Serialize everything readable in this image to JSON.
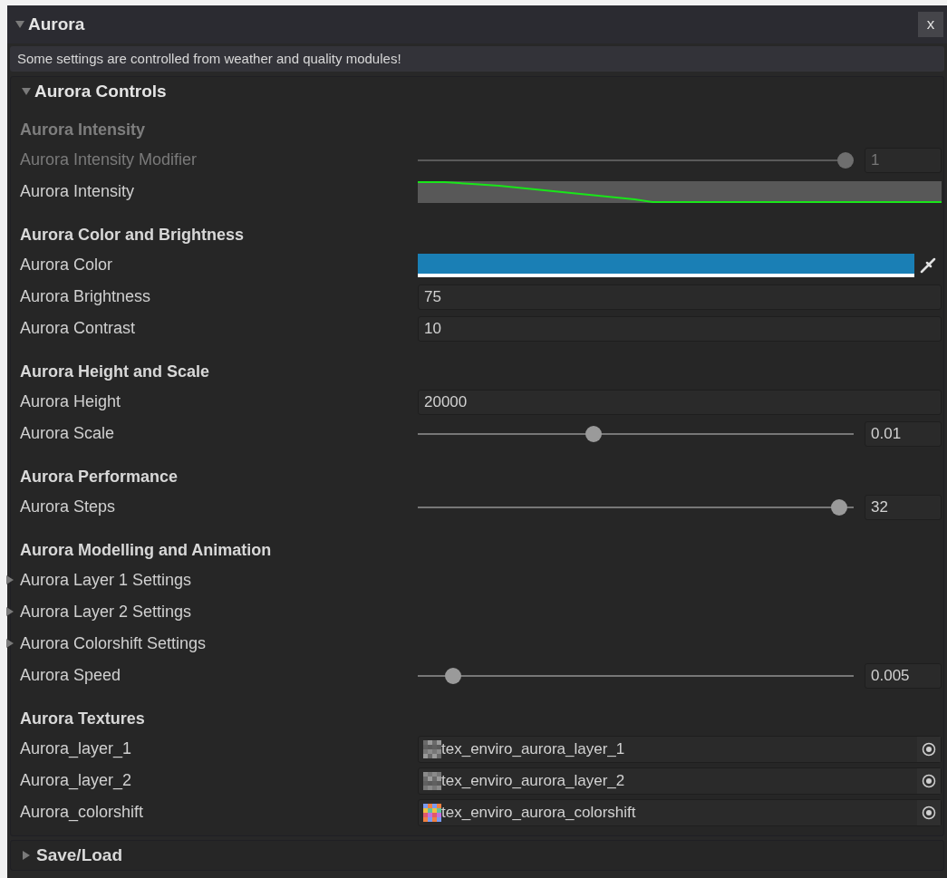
{
  "panel": {
    "title": "Aurora",
    "expanded": true,
    "close": "x"
  },
  "info": "Some settings are controlled from weather and quality modules!",
  "controls": {
    "title": "Aurora Controls",
    "expanded": true,
    "sections": [
      {
        "heading": "Aurora Intensity",
        "disabled": true,
        "rows": [
          {
            "kind": "slider",
            "label": "Aurora Intensity Modifier",
            "disabled": true,
            "level": 1,
            "value": "1"
          },
          {
            "kind": "curve",
            "label": "Aurora Intensity",
            "disabled": false
          }
        ]
      },
      {
        "heading": "Aurora Color and Brightness",
        "disabled": false,
        "rows": [
          {
            "kind": "color",
            "label": "Aurora Color",
            "disabled": false,
            "color": "#1a7fb5"
          },
          {
            "kind": "number",
            "label": "Aurora Brightness",
            "disabled": false,
            "value": "75"
          },
          {
            "kind": "number",
            "label": "Aurora Contrast",
            "disabled": false,
            "value": "10"
          }
        ]
      },
      {
        "heading": "Aurora Height and Scale",
        "disabled": false,
        "rows": [
          {
            "kind": "number",
            "label": "Aurora Height",
            "disabled": false,
            "value": "20000"
          },
          {
            "kind": "slider",
            "label": "Aurora Scale",
            "disabled": false,
            "level": 0.4,
            "value": "0.01"
          }
        ]
      },
      {
        "heading": "Aurora Performance",
        "disabled": false,
        "rows": [
          {
            "kind": "slider",
            "label": "Aurora Steps",
            "disabled": false,
            "level": 0.985,
            "value": "32"
          }
        ]
      },
      {
        "heading": "Aurora Modelling and Animation",
        "disabled": false,
        "rows": [
          {
            "kind": "foldout",
            "label": "Aurora Layer 1 Settings",
            "disabled": false,
            "expanded": false
          },
          {
            "kind": "foldout",
            "label": "Aurora Layer 2 Settings",
            "disabled": false,
            "expanded": false
          },
          {
            "kind": "foldout",
            "label": "Aurora Colorshift Settings",
            "disabled": false,
            "expanded": false
          },
          {
            "kind": "slider",
            "label": "Aurora Speed",
            "disabled": false,
            "level": 0.065,
            "value": "0.005"
          }
        ]
      },
      {
        "heading": "Aurora Textures",
        "disabled": false,
        "rows": [
          {
            "kind": "texture",
            "label": "Aurora_layer_1",
            "disabled": false,
            "value": "tex_enviro_aurora_layer_1"
          },
          {
            "kind": "texture",
            "label": "Aurora_layer_2",
            "disabled": false,
            "value": "tex_enviro_aurora_layer_2"
          },
          {
            "kind": "texture",
            "label": "Aurora_colorshift",
            "disabled": false,
            "value": "tex_enviro_aurora_colorshift"
          }
        ]
      }
    ]
  },
  "save_load": {
    "title": "Save/Load",
    "expanded": false
  }
}
